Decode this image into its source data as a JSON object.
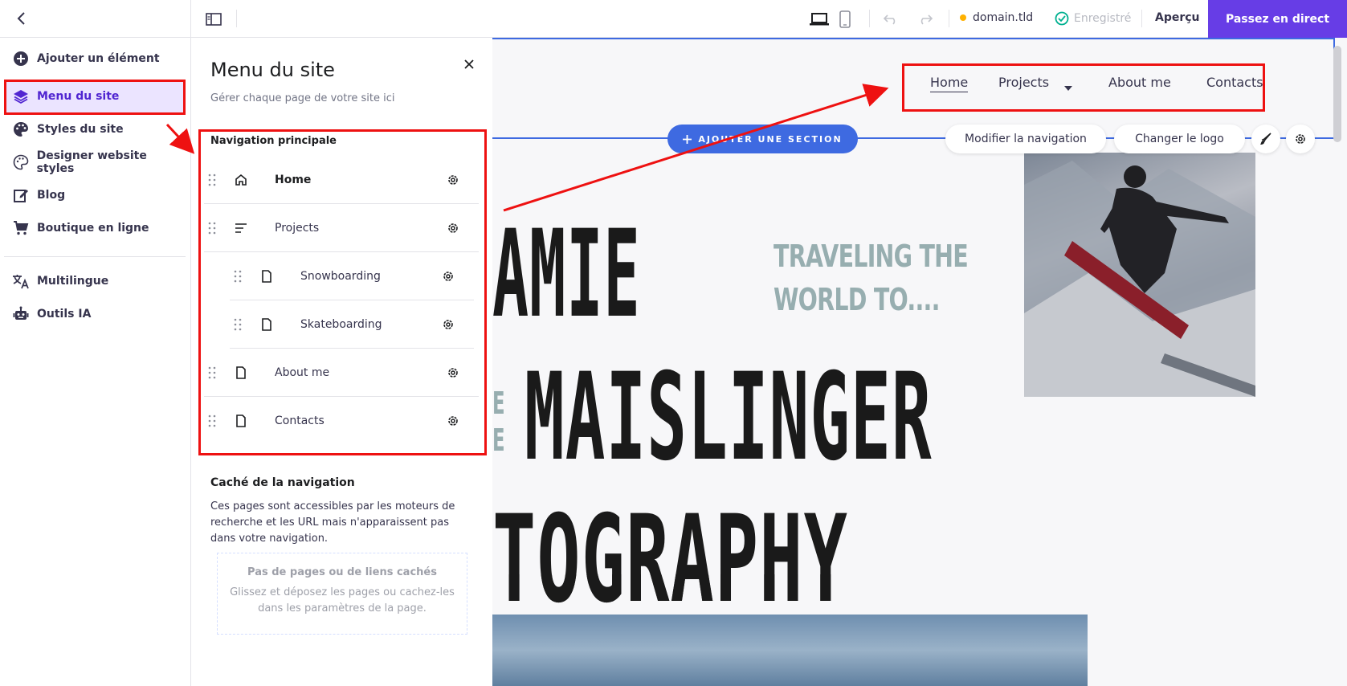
{
  "topbar": {
    "domain": "domain.tld",
    "saved": "Enregistré",
    "preview": "Aperçu",
    "go_live": "Passez en direct"
  },
  "sidebar": {
    "items": [
      {
        "label": "Ajouter un élément",
        "icon": "plus-circle-icon"
      },
      {
        "label": "Menu du site",
        "icon": "layers-icon",
        "active": true
      },
      {
        "label": "Styles du site",
        "icon": "palette-icon"
      },
      {
        "label": "Designer website styles",
        "icon": "palette-outline-icon"
      },
      {
        "label": "Blog",
        "icon": "edit-icon"
      },
      {
        "label": "Boutique en ligne",
        "icon": "cart-icon"
      },
      {
        "label": "Multilingue",
        "icon": "translate-icon"
      },
      {
        "label": "Outils IA",
        "icon": "robot-icon"
      }
    ]
  },
  "panel": {
    "title": "Menu du site",
    "subtitle": "Gérer chaque page de votre site ici",
    "nav_heading": "Navigation principale",
    "nav_items": [
      {
        "label": "Home",
        "icon": "home-icon",
        "bold": true
      },
      {
        "label": "Projects",
        "icon": "lines-icon"
      },
      {
        "label": "Snowboarding",
        "icon": "page-icon",
        "child": true
      },
      {
        "label": "Skateboarding",
        "icon": "page-icon",
        "child": true
      },
      {
        "label": "About me",
        "icon": "page-icon"
      },
      {
        "label": "Contacts",
        "icon": "page-icon"
      }
    ],
    "hidden_heading": "Caché de la navigation",
    "hidden_desc": "Ces pages sont accessibles par les moteurs de recherche et les URL mais n'apparaissent pas dans votre navigation.",
    "empty_title": "Pas de pages ou de liens cachés",
    "empty_desc": "Glissez et déposez les pages ou cachez-les dans les paramètres de la page."
  },
  "site": {
    "nav": [
      "Home",
      "Projects",
      "About me",
      "Contacts"
    ],
    "add_section": "AJOUTER UNE SECTION",
    "edit_nav": "Modifier la navigation",
    "change_logo": "Changer le logo",
    "hero_line1": "AMIE",
    "hero_line2": "MAISLINGER",
    "hero_line3": "TOGRAPHY",
    "tagline1": "TRAVELING THE",
    "tagline2": "WORLD TO....",
    "side_letters": "E\nE"
  },
  "colors": {
    "accent": "#673de6",
    "active_bg": "#ebe4ff",
    "highlight_red": "#e11111",
    "section_blue": "#3e6ae1"
  }
}
